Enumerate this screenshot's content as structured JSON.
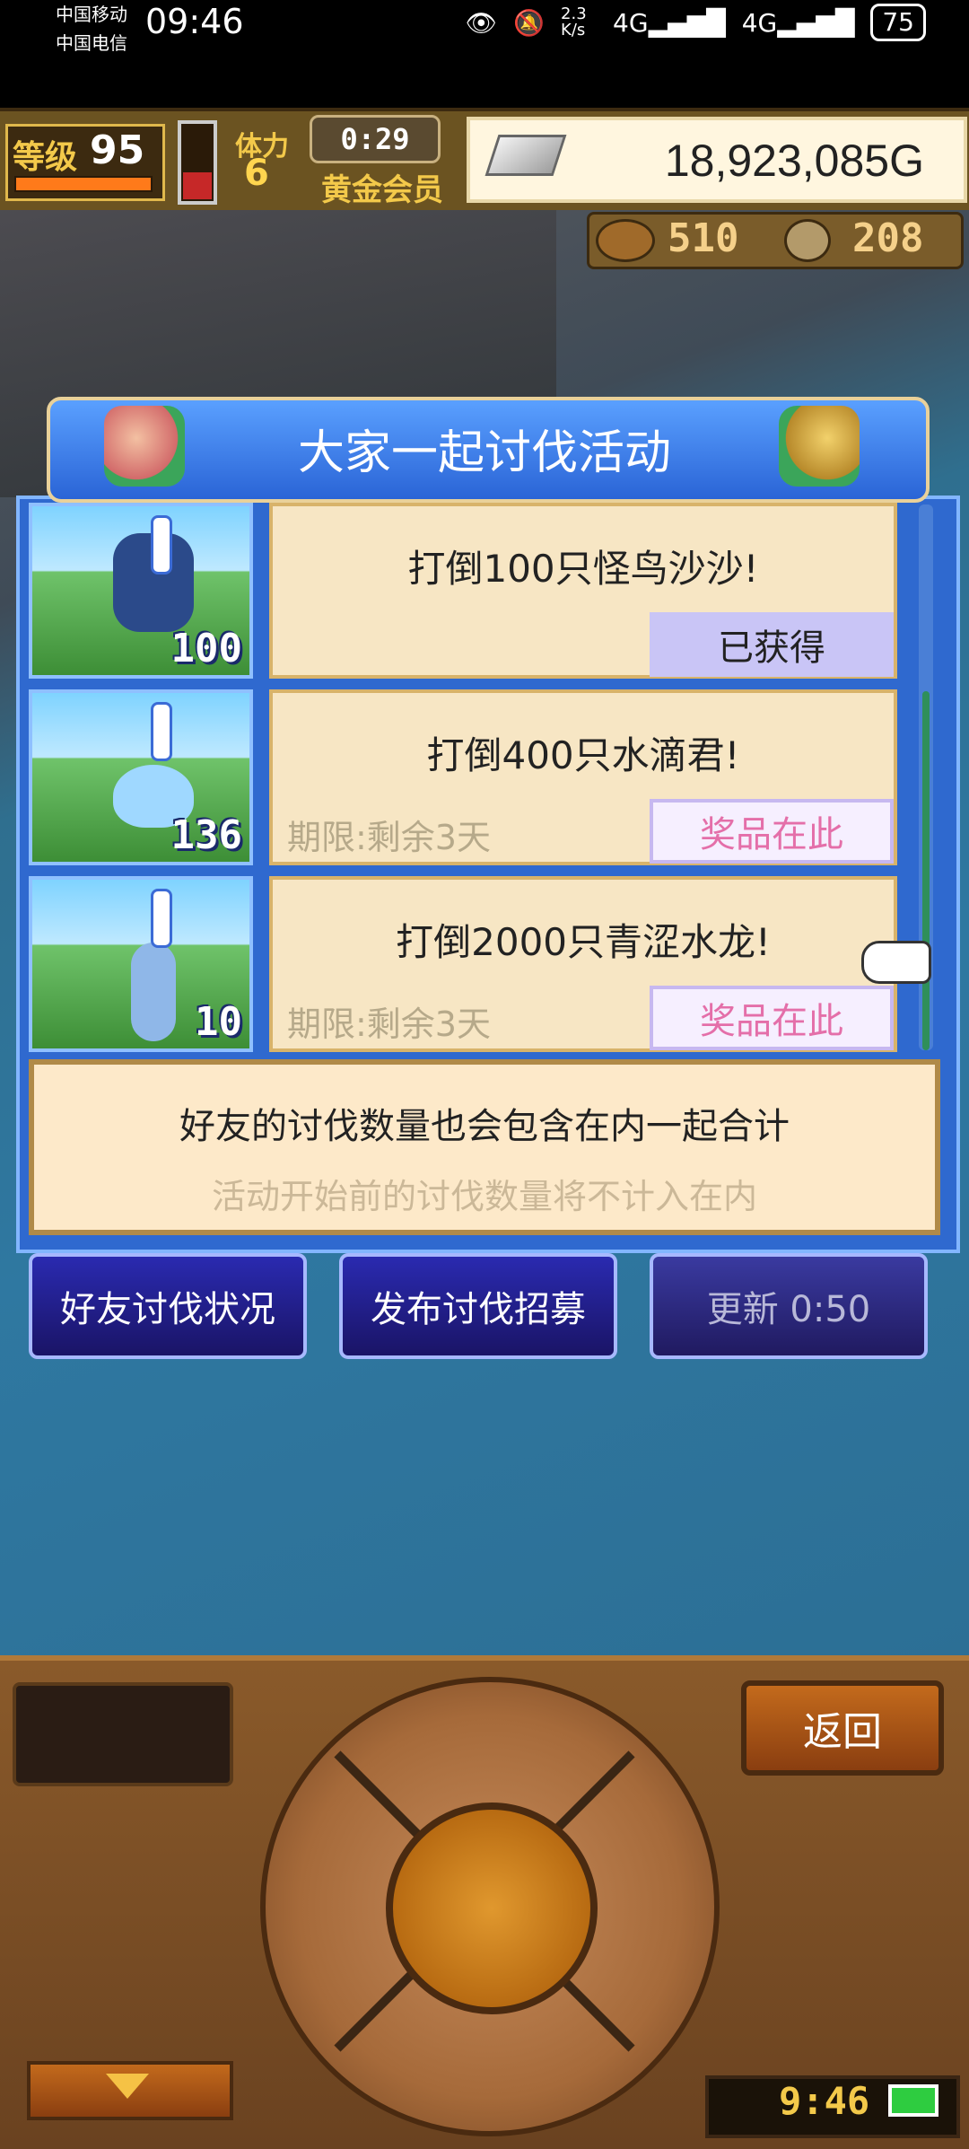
{
  "status_bar": {
    "carrier1": "中国移动",
    "carrier2": "中国电信",
    "time": "09:46",
    "speed": "2.3 K/s",
    "signal1": "4G",
    "signal2": "4G",
    "battery": "75"
  },
  "top_bar": {
    "level_label": "等级",
    "level_value": "95",
    "stamina_label": "体力",
    "stamina_value": "6",
    "timer": "0:29",
    "membership": "黄金会员",
    "money": "18,923,085G"
  },
  "resources": {
    "value1": "510",
    "value2": "208"
  },
  "dialog": {
    "title": "大家一起讨伐活动",
    "quests": [
      {
        "count_badge": "100",
        "title": "打倒100只怪鸟沙沙!",
        "deadline": "",
        "button": "已获得",
        "monster_color": "#2b4a8a"
      },
      {
        "count_badge": "136",
        "title": "打倒400只水滴君!",
        "deadline": "期限:剩余3天",
        "button": "奖品在此",
        "monster_color": "#9fd8ff"
      },
      {
        "count_badge": "10",
        "title": "打倒2000只青涩水龙!",
        "deadline": "期限:剩余3天",
        "button": "奖品在此",
        "monster_color": "#8fb7e8"
      }
    ],
    "info_line1": "好友的讨伐数量也会包含在内一起合计",
    "info_line2": "活动开始前的讨伐数量将不计入在内"
  },
  "actions": {
    "friend_status": "好友讨伐状况",
    "post_recruit": "发布讨伐招募",
    "refresh": "更新 0:50"
  },
  "controller": {
    "back": "返回",
    "clock": "9:46"
  }
}
